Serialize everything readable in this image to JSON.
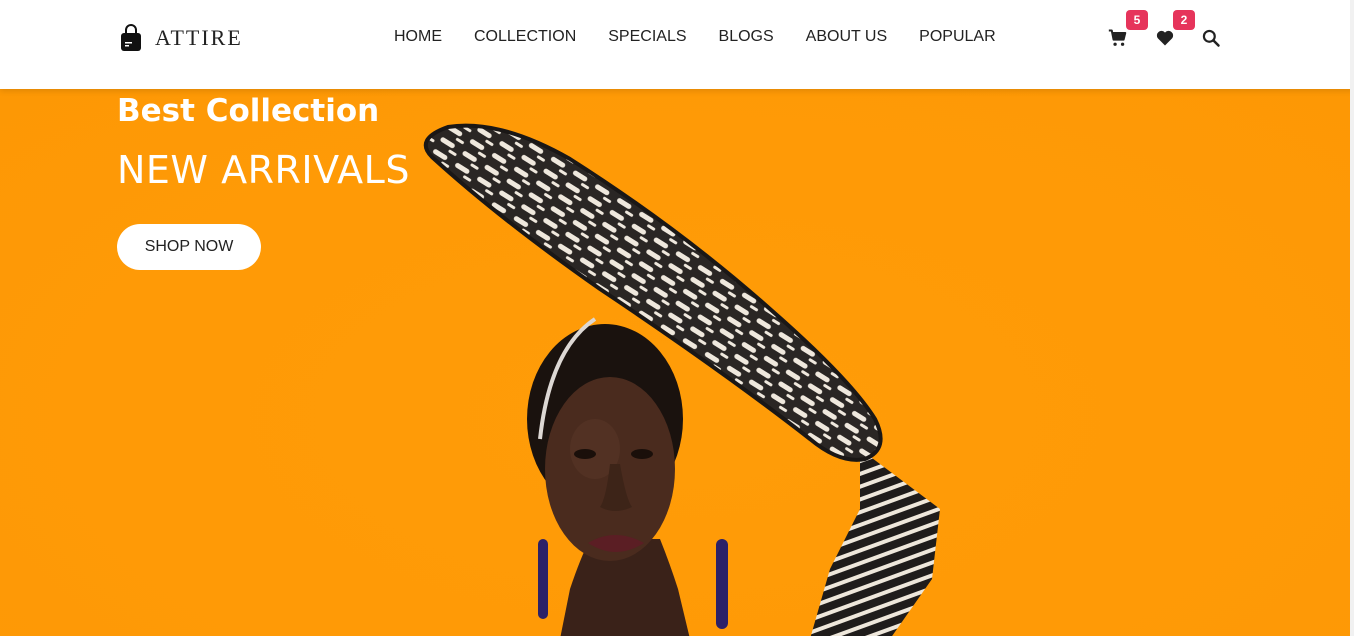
{
  "brand": {
    "name": "ATTIRE"
  },
  "nav": {
    "items": [
      {
        "label": "HOME"
      },
      {
        "label": "COLLECTION"
      },
      {
        "label": "SPECIALS"
      },
      {
        "label": "BLOGS"
      },
      {
        "label": "ABOUT US"
      },
      {
        "label": "POPULAR"
      }
    ]
  },
  "header_icons": {
    "cart": {
      "icon": "cart-icon",
      "count": "5"
    },
    "wishlist": {
      "icon": "heart-icon",
      "count": "2"
    },
    "search": {
      "icon": "search-icon"
    }
  },
  "hero": {
    "subtitle": "Best Collection",
    "title": "NEW ARRIVALS",
    "cta_label": "SHOP NOW",
    "background_color": "#ff9a06"
  },
  "colors": {
    "badge": "#e6345b",
    "text": "#222222",
    "header_bg": "#ffffff"
  }
}
